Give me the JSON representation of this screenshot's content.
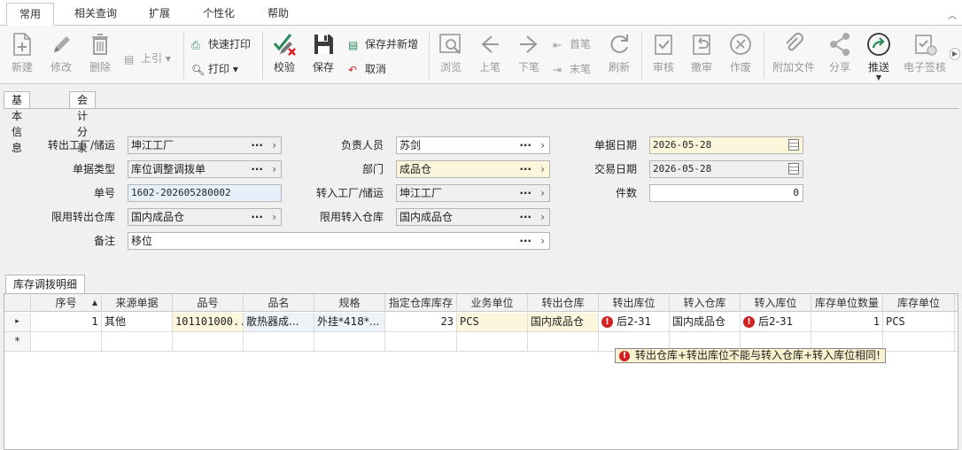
{
  "ribbon_tabs": [
    {
      "label": "常用",
      "active": true
    },
    {
      "label": "相关查询"
    },
    {
      "label": "扩展"
    },
    {
      "label": "个性化"
    },
    {
      "label": "帮助"
    }
  ],
  "toolbar": {
    "new": "新建",
    "edit": "修改",
    "delete": "删除",
    "prev_ref": "上引",
    "quick_print": "快速打印",
    "print": "打印",
    "check": "校验",
    "save": "保存",
    "save_new": "保存并新增",
    "cancel": "取消",
    "browse": "浏览",
    "prev": "上笔",
    "next": "下笔",
    "first": "首笔",
    "last": "末笔",
    "refresh": "刷新",
    "approve": "审核",
    "unapprove": "撤审",
    "void": "作废",
    "attach": "附加文件",
    "share": "分享",
    "push": "推送",
    "esign": "电子签核"
  },
  "form_tabs": [
    {
      "label": "基本信息",
      "active": true
    },
    {
      "label": "会计分录"
    }
  ],
  "form": {
    "out_factory": {
      "label": "转出工厂/储运",
      "value": "坤江工厂"
    },
    "doc_type": {
      "label": "单据类型",
      "value": "库位调整调拨单"
    },
    "doc_no": {
      "label": "单号",
      "value": "1602-202605280002"
    },
    "limit_out_wh": {
      "label": "限用转出仓库",
      "value": "国内成品仓"
    },
    "remark": {
      "label": "备注",
      "value": "移位"
    },
    "owner": {
      "label": "负责人员",
      "value": "苏剑"
    },
    "dept": {
      "label": "部门",
      "value": "成品仓"
    },
    "in_factory": {
      "label": "转入工厂/储运",
      "value": "坤江工厂"
    },
    "limit_in_wh": {
      "label": "限用转入仓库",
      "value": "国内成品仓"
    },
    "doc_date": {
      "label": "单据日期",
      "value": "2026-05-28"
    },
    "trade_date": {
      "label": "交易日期",
      "value": "2026-05-28"
    },
    "count": {
      "label": "件数",
      "value": "0"
    }
  },
  "detail": {
    "tab_label": "库存调拨明细",
    "columns": [
      "序号",
      "来源单据",
      "品号",
      "品名",
      "规格",
      "指定仓库库存",
      "业务单位",
      "转出仓库",
      "转出库位",
      "转入仓库",
      "转入库位",
      "库存单位数量",
      "库存单位"
    ],
    "rows": [
      {
        "seq": "1",
        "source": "其他",
        "item_no": "101101000...",
        "item_name": "散热器成...",
        "spec": "外挂*418*...",
        "stock": "23",
        "biz_unit": "PCS",
        "out_wh": "国内成品仓",
        "out_loc": "后2-31",
        "in_wh": "国内成品仓",
        "in_loc": "后2-31",
        "qty": "1",
        "unit": "PCS"
      }
    ],
    "new_row_marker": "*",
    "current_row_marker": "▸"
  },
  "error_tooltip": "转出仓库+转出库位不能与转入仓库+转入库位相同!",
  "colors": {
    "required_field": "#fbf6dc",
    "error": "#d32020",
    "accent": "#2a8a5a"
  }
}
